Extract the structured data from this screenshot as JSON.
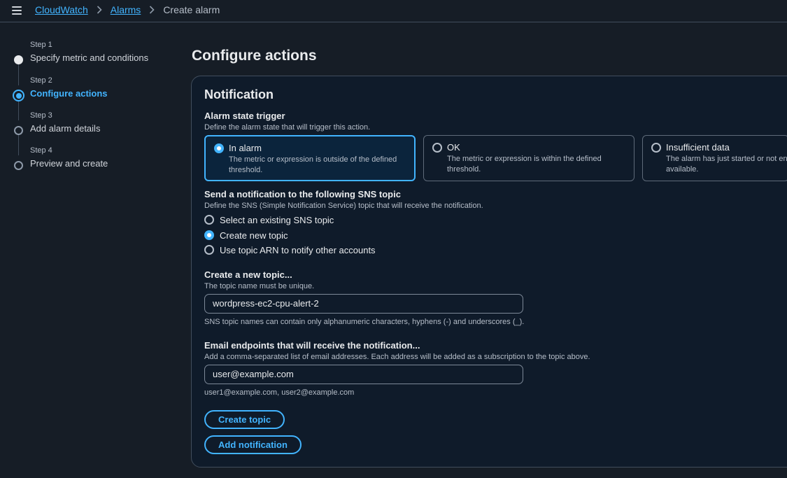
{
  "breadcrumb": {
    "items": [
      "CloudWatch",
      "Alarms"
    ],
    "current": "Create alarm"
  },
  "steps": [
    {
      "label": "Step 1",
      "title": "Specify metric and conditions",
      "state": "done"
    },
    {
      "label": "Step 2",
      "title": "Configure actions",
      "state": "active"
    },
    {
      "label": "Step 3",
      "title": "Add alarm details",
      "state": "pending"
    },
    {
      "label": "Step 4",
      "title": "Preview and create",
      "state": "pending"
    }
  ],
  "page_title": "Configure actions",
  "notification": {
    "title": "Notification",
    "trigger": {
      "label": "Alarm state trigger",
      "description": "Define the alarm state that will trigger this action.",
      "options": [
        {
          "title": "In alarm",
          "desc": "The metric or expression is outside of the defined threshold.",
          "selected": true
        },
        {
          "title": "OK",
          "desc": "The metric or expression is within the defined threshold.",
          "selected": false
        },
        {
          "title": "Insufficient data",
          "desc": "The alarm has just started or not enough data is available.",
          "selected": false
        }
      ]
    },
    "sns": {
      "label": "Send a notification to the following SNS topic",
      "description": "Define the SNS (Simple Notification Service) topic that will receive the notification.",
      "options": [
        {
          "label": "Select an existing SNS topic",
          "selected": false
        },
        {
          "label": "Create new topic",
          "selected": true
        },
        {
          "label": "Use topic ARN to notify other accounts",
          "selected": false
        }
      ]
    },
    "new_topic": {
      "label": "Create a new topic...",
      "description": "The topic name must be unique.",
      "value": "wordpress-ec2-cpu-alert-2",
      "hint": "SNS topic names can contain only alphanumeric characters, hyphens (-) and underscores (_)."
    },
    "email": {
      "label": "Email endpoints that will receive the notification...",
      "description": "Add a comma-separated list of email addresses. Each address will be added as a subscription to the topic above.",
      "value": "user@example.com",
      "hint": "user1@example.com, user2@example.com"
    },
    "create_topic_label": "Create topic",
    "add_notification_label": "Add notification"
  },
  "colors": {
    "accent": "#42b4ff",
    "background": "#161d26",
    "panel": "#0f1b2a",
    "border": "#414d5c"
  }
}
